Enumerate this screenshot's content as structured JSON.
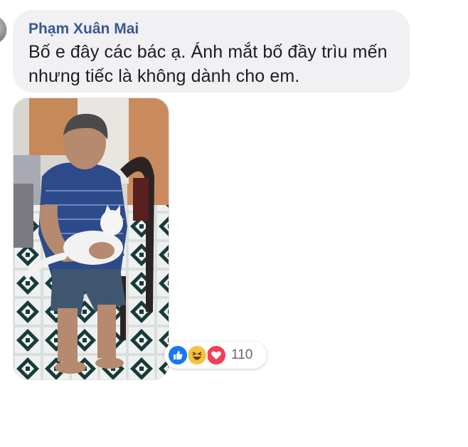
{
  "comment": {
    "author": "Phạm Xuân Mai",
    "text": "Bố e đây các bác ạ. Ánh mắt bố đầy trìu mến nhưng tiếc là không dành cho em."
  },
  "attachment": {
    "type": "photo"
  },
  "reactions": {
    "icons": [
      "like-icon",
      "haha-icon",
      "love-icon"
    ],
    "count": "110",
    "colors": {
      "like": "#1877f2",
      "haha": "#f7c33f",
      "love": "#f33e58"
    }
  },
  "colors": {
    "author_name": "#385898",
    "bubble_bg": "#f1f0f2",
    "text": "#1c1e21"
  }
}
